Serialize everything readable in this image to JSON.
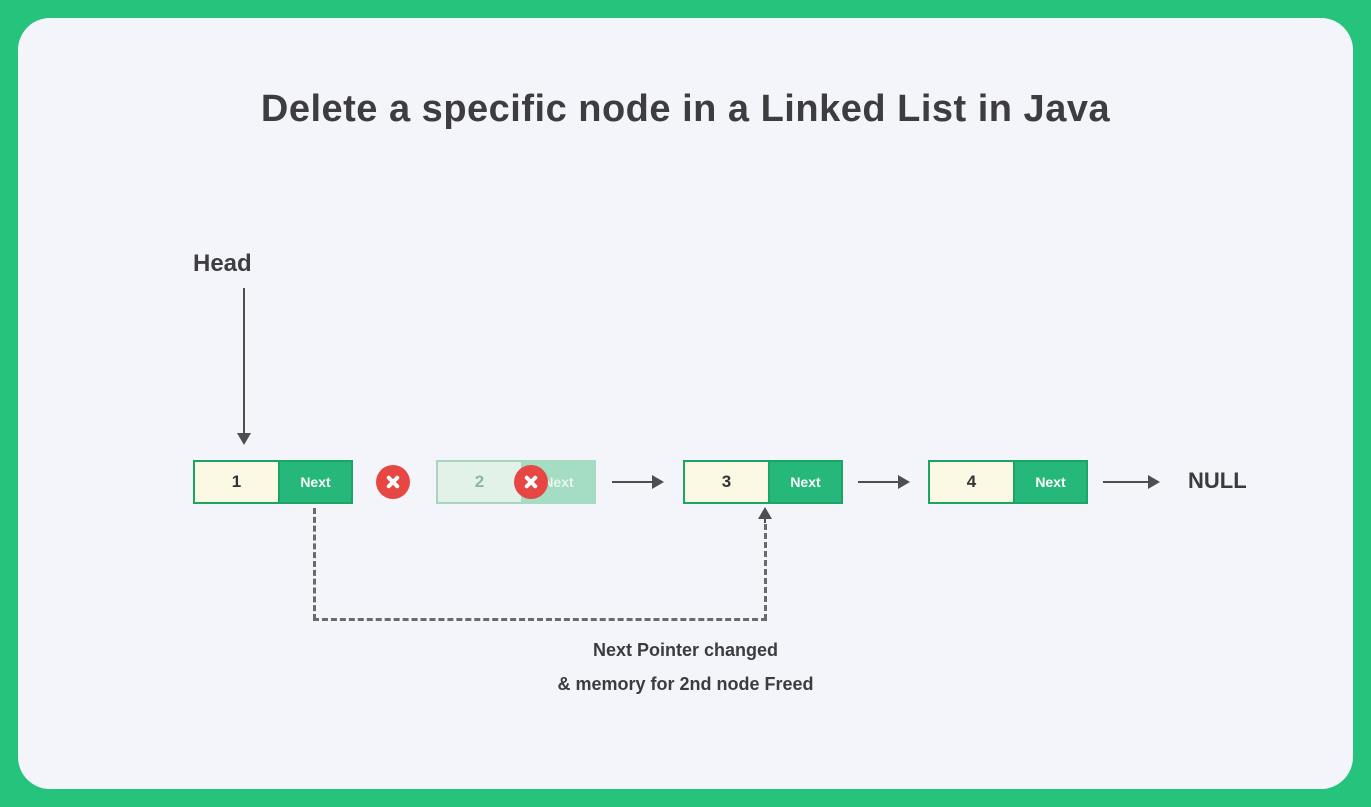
{
  "title": "Delete a specific node in a Linked List in Java",
  "head_label": "Head",
  "null_label": "NULL",
  "caption_line1": "Next Pointer changed",
  "caption_line2": "& memory for 2nd node Freed",
  "nodes": [
    {
      "value": "1",
      "next": "Next",
      "deleted": false
    },
    {
      "value": "2",
      "next": "Next",
      "deleted": true
    },
    {
      "value": "3",
      "next": "Next",
      "deleted": false
    },
    {
      "value": "4",
      "next": "Next",
      "deleted": false
    }
  ]
}
